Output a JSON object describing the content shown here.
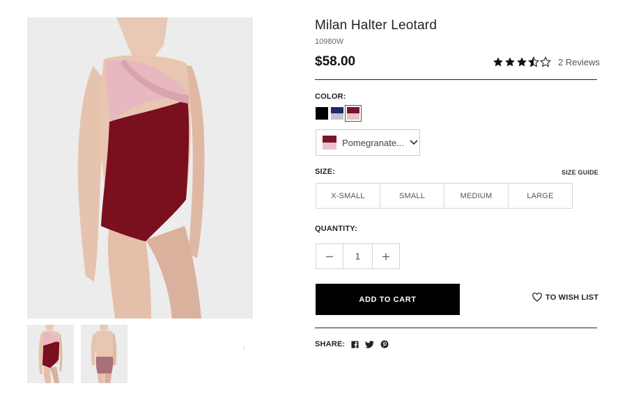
{
  "product": {
    "title": "Milan Halter Leotard",
    "sku": "10980W",
    "price": "$58.00",
    "rating": 3.5,
    "rating_max": 5,
    "reviews_label": "2 Reviews"
  },
  "gallery": {
    "main_image": "leotard-front-photo",
    "thumbnails": [
      "leotard-front-thumb",
      "leotard-back-thumb"
    ],
    "next_icon": "chevron-right-icon",
    "next_glyph": "›"
  },
  "color": {
    "label": "COLOR:",
    "swatches": [
      {
        "name": "black",
        "top": "#000000",
        "bottom": "#000000"
      },
      {
        "name": "navy",
        "top": "#1d2c66",
        "bottom": "#c2c5d2"
      },
      {
        "name": "pomegranate",
        "top": "#7a1629",
        "bottom": "#e9c3c9",
        "selected": true
      }
    ],
    "selected_text": "Pomegranate...",
    "dropdown_icon": "chevron-down-icon"
  },
  "size": {
    "label": "SIZE:",
    "guide_label": "SIZE GUIDE",
    "options": [
      "X-SMALL",
      "SMALL",
      "MEDIUM",
      "LARGE"
    ]
  },
  "quantity": {
    "label": "QUANTITY:",
    "value": "1",
    "decrement_icon": "minus-icon",
    "increment_icon": "plus-icon"
  },
  "actions": {
    "add_to_cart": "ADD TO CART",
    "wishlist": "TO WISH LIST",
    "wishlist_icon": "heart-icon"
  },
  "share": {
    "label": "SHARE:",
    "icons": [
      "facebook-icon",
      "twitter-icon",
      "pinterest-icon"
    ]
  },
  "colors": {
    "accent": "#000000",
    "leotard_main": "#7a0f1e",
    "leotard_trim": "#e7b8c0",
    "image_bg": "#ececec"
  }
}
